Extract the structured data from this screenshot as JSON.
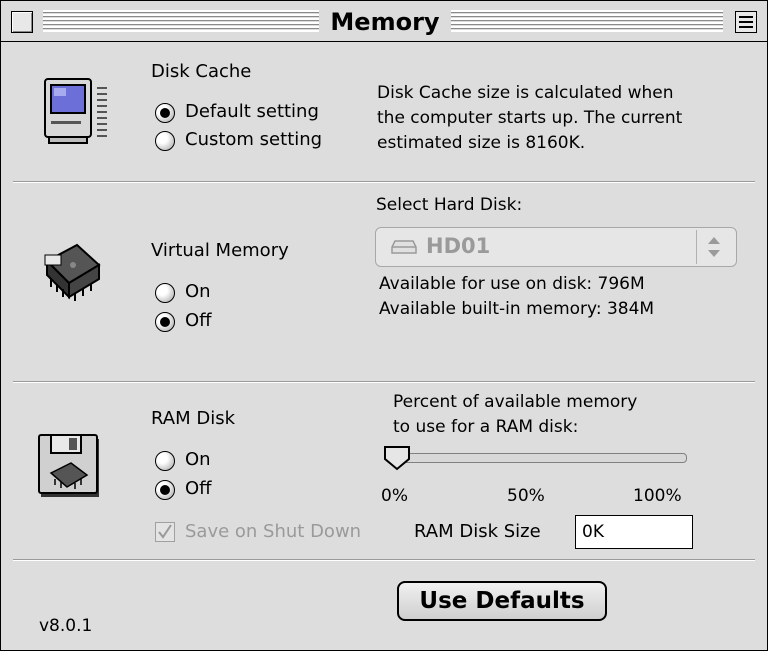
{
  "window": {
    "title": "Memory",
    "version": "v8.0.1"
  },
  "disk_cache": {
    "label": "Disk Cache",
    "options": [
      "Default setting",
      "Custom setting"
    ],
    "selected": "Default setting",
    "description": [
      "Disk Cache size is calculated when",
      "the computer starts up. The current",
      "estimated size is 8160K."
    ],
    "icon": "computer-icon"
  },
  "virtual_memory": {
    "label": "Virtual Memory",
    "options": [
      "On",
      "Off"
    ],
    "selected": "Off",
    "select_label": "Select Hard Disk:",
    "disk_value": "HD01",
    "available_disk": "Available for use on disk: 796M",
    "available_memory": "Available built-in memory: 384M",
    "icon": "memory-chip-icon"
  },
  "ram_disk": {
    "label": "RAM Disk",
    "options": [
      "On",
      "Off"
    ],
    "selected": "Off",
    "percent_label": [
      "Percent of available memory",
      "to use for a RAM disk:"
    ],
    "slider_percent": 0,
    "ticks": [
      "0%",
      "50%",
      "100%"
    ],
    "save_label": "Save on Shut Down",
    "save_checked": true,
    "size_label": "RAM Disk Size",
    "size_value": "0K",
    "icon": "ram-disk-icon"
  },
  "buttons": {
    "use_defaults": "Use Defaults"
  }
}
